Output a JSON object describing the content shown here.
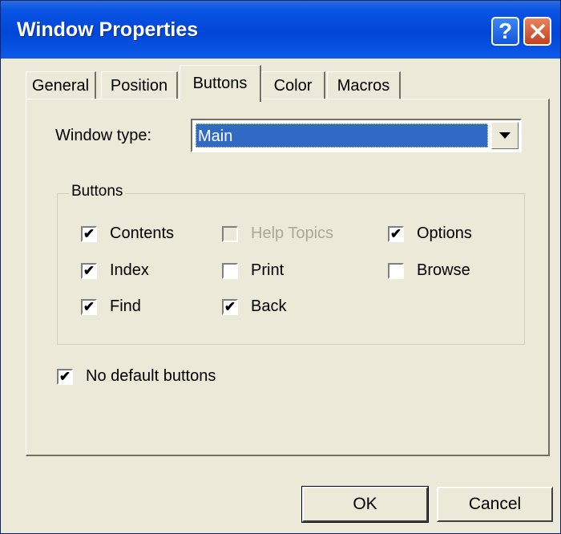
{
  "dialog": {
    "title": "Window Properties",
    "help_glyph": "?",
    "close_glyph": "✕"
  },
  "tabs": [
    {
      "label": "General"
    },
    {
      "label": "Position"
    },
    {
      "label": "Buttons",
      "active": true
    },
    {
      "label": "Color"
    },
    {
      "label": "Macros"
    }
  ],
  "window_type": {
    "label": "Window type:",
    "value": "Main"
  },
  "buttons_group": {
    "label": "Buttons",
    "items": [
      {
        "label": "Contents",
        "checked": true,
        "disabled": false
      },
      {
        "label": "Help Topics",
        "checked": false,
        "disabled": true
      },
      {
        "label": "Options",
        "checked": true,
        "disabled": false
      },
      {
        "label": "Index",
        "checked": true,
        "disabled": false
      },
      {
        "label": "Print",
        "checked": false,
        "disabled": false
      },
      {
        "label": "Browse",
        "checked": false,
        "disabled": false
      },
      {
        "label": "Find",
        "checked": true,
        "disabled": false
      },
      {
        "label": "Back",
        "checked": true,
        "disabled": false
      }
    ]
  },
  "no_default": {
    "label": "No default buttons",
    "checked": true
  },
  "footer": {
    "ok_label": "OK",
    "cancel_label": "Cancel"
  },
  "colors": {
    "title_bar": "#0046d8",
    "selection": "#316ac5",
    "face": "#ece9d8"
  }
}
